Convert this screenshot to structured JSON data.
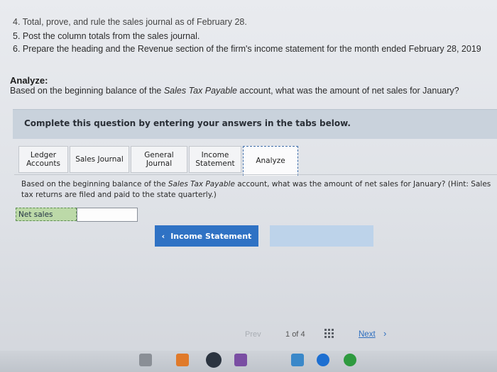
{
  "instructions": {
    "line4": "4. Total, prove, and rule the sales journal as of February 28.",
    "line5": "5. Post the column totals from the sales journal.",
    "line6": "6. Prepare the heading and the Revenue section of the firm's income statement for the month ended February 28, 2019"
  },
  "analyze": {
    "title": "Analyze:",
    "question_pre": "Based on the beginning balance of the ",
    "question_em": "Sales Tax Payable",
    "question_post": " account, what was the amount of net sales for January?"
  },
  "panel": {
    "banner": "Complete this question by entering your answers in the tabs below."
  },
  "tabs": [
    {
      "label": "Ledger Accounts"
    },
    {
      "label": "Sales Journal"
    },
    {
      "label": "General Journal"
    },
    {
      "label": "Income Statement"
    },
    {
      "label": "Analyze"
    }
  ],
  "inner_question": {
    "pre": "Based on the beginning balance of the ",
    "em": "Sales Tax Payable",
    "post": " account, what was the amount of net sales for January? (Hint: Sales",
    "line2": "tax returns are filed and paid to the state quarterly.)"
  },
  "answer": {
    "label": "Net sales",
    "value": ""
  },
  "nav": {
    "prev_button": "Income Statement",
    "prev_arrow": "‹",
    "next_button": ""
  },
  "pager": {
    "prev": "Prev",
    "page": "1",
    "of": "of",
    "total": "4",
    "next": "Next",
    "next_arrow": "›"
  },
  "colors": {
    "primary_button": "#2f72c4",
    "answer_label_bg": "#bcd9a8",
    "banner_bg": "#c9d2dc"
  }
}
